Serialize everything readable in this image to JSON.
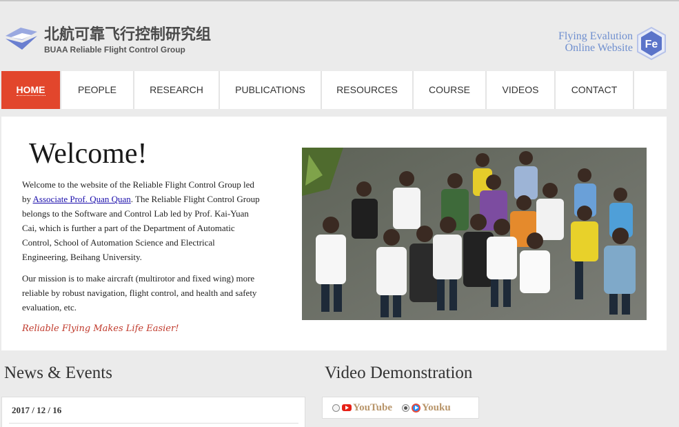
{
  "header": {
    "logo_cn": "北航可靠飞行控制研究组",
    "logo_en": "BUAA  Reliable Flight Control Group",
    "fe_line1": "Flying Evalution",
    "fe_line2": "Online Website",
    "fe_badge": "Fe"
  },
  "nav": {
    "items": [
      {
        "label": "HOME",
        "active": true
      },
      {
        "label": "PEOPLE"
      },
      {
        "label": "RESEARCH"
      },
      {
        "label": "PUBLICATIONS"
      },
      {
        "label": "RESOURCES"
      },
      {
        "label": "COURSE"
      },
      {
        "label": "VIDEOS"
      },
      {
        "label": "CONTACT"
      }
    ]
  },
  "welcome": {
    "title": "Welcome!",
    "p1_before": "Welcome to the website of the Reliable Flight Control Group led by ",
    "p1_link": "Associate Prof. Quan Quan",
    "p1_after": ". The Reliable Flight Control Group belongs to the Software and Control Lab led by Prof. Kai-Yuan Cai, which is further a part of the Department of Automatic Control, School of Automation Science and Electrical Engineering, Beihang University.",
    "p2": "Our mission is to make aircraft (multirotor and fixed wing) more reliable by robust navigation, flight control, and health and safety evaluation, etc.",
    "tagline": "Reliable Flying Makes Life Easier!"
  },
  "news": {
    "title": "News & Events",
    "first_date": "2017 / 12 / 16"
  },
  "video": {
    "title": "Video Demonstration",
    "options": [
      {
        "label": "YouTube",
        "checked": false
      },
      {
        "label": "Youku",
        "checked": true
      }
    ]
  },
  "colors": {
    "accent": "#e2462c",
    "link_blue": "#6f8fcf",
    "tagline": "#c0392b",
    "video_label": "#b8956a"
  }
}
